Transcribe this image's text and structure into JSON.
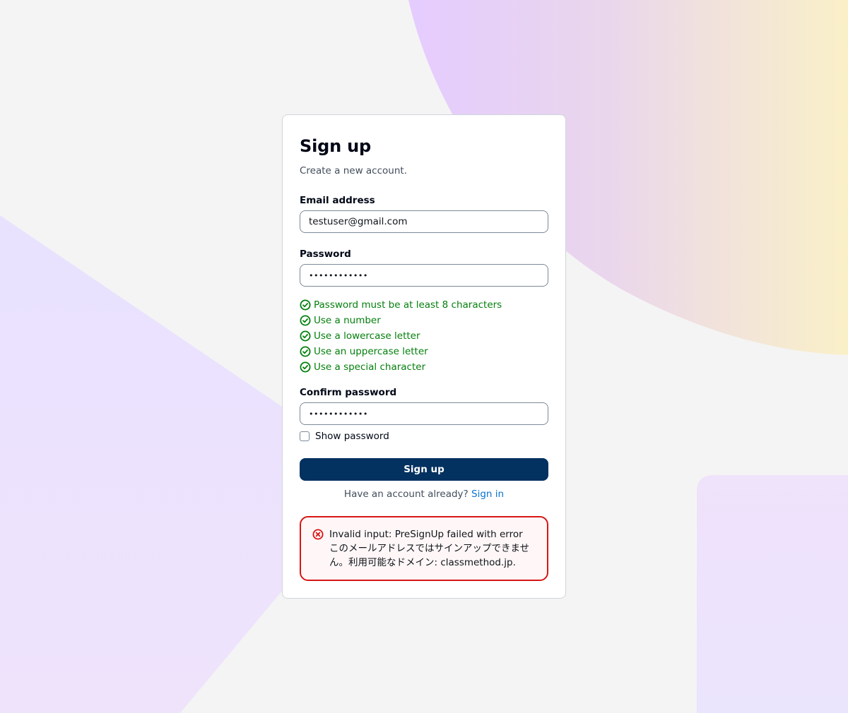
{
  "form": {
    "title": "Sign up",
    "subtitle": "Create a new account.",
    "email_label": "Email address",
    "email_value": "testuser@gmail.com",
    "password_label": "Password",
    "password_value": "••••••••••••",
    "password_rules": [
      "Password must be at least 8 characters",
      "Use a number",
      "Use a lowercase letter",
      "Use an uppercase letter",
      "Use a special character"
    ],
    "confirm_label": "Confirm password",
    "confirm_value": "••••••••••••",
    "show_password_label": "Show password",
    "submit_label": "Sign up",
    "have_account_text": "Have an account already?",
    "signin_link": "Sign in",
    "error_message": "Invalid input: PreSignUp failed with error このメールアドレスではサインアップできません。利用可能なドメイン: classmethod.jp."
  },
  "colors": {
    "success": "#037f0c",
    "error": "#d91515",
    "primary_button": "#033160",
    "link": "#0972d3"
  },
  "icons": {
    "rule_status": "check-circle-icon",
    "error_status": "error-circle-icon"
  }
}
